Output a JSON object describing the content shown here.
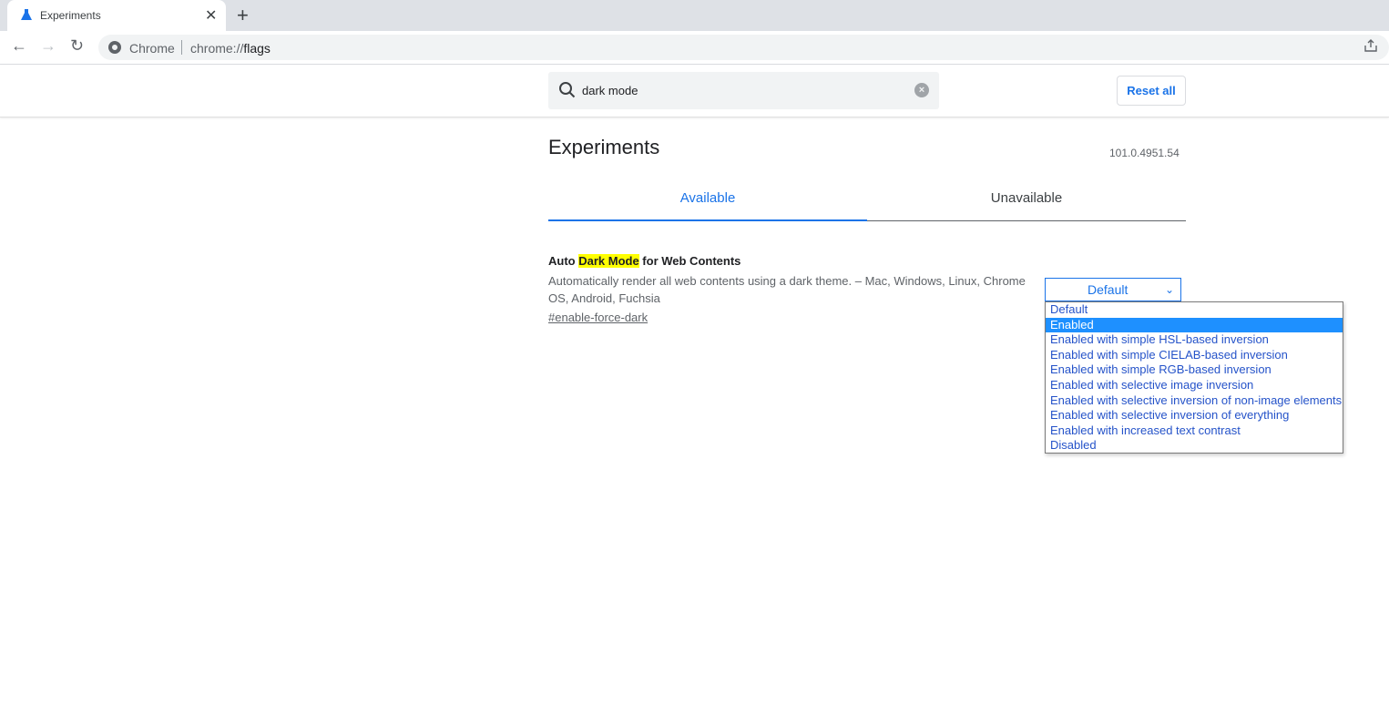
{
  "browser": {
    "tab_title": "Experiments",
    "omnibox_site": "Chrome",
    "omnibox_url_prefix": "chrome://",
    "omnibox_url_path": "flags"
  },
  "search": {
    "value": "dark mode",
    "reset_label": "Reset all"
  },
  "page": {
    "title": "Experiments",
    "version": "101.0.4951.54",
    "tabs": [
      {
        "label": "Available",
        "active": true
      },
      {
        "label": "Unavailable",
        "active": false
      }
    ]
  },
  "flag": {
    "title_pre": "Auto ",
    "title_highlight": "Dark Mode",
    "title_post": " for Web Contents",
    "description": "Automatically render all web contents using a dark theme. – Mac, Windows, Linux, Chrome OS, Android, Fuchsia",
    "anchor": "#enable-force-dark",
    "selected": "Default",
    "options": [
      "Default",
      "Enabled",
      "Enabled with simple HSL-based inversion",
      "Enabled with simple CIELAB-based inversion",
      "Enabled with simple RGB-based inversion",
      "Enabled with selective image inversion",
      "Enabled with selective inversion of non-image elements",
      "Enabled with selective inversion of everything",
      "Enabled with increased text contrast",
      "Disabled"
    ],
    "highlighted_option": "Enabled"
  },
  "colors": {
    "accent": "#1a73e8",
    "highlight": "#ffff00",
    "option_highlight": "#1e90ff"
  }
}
